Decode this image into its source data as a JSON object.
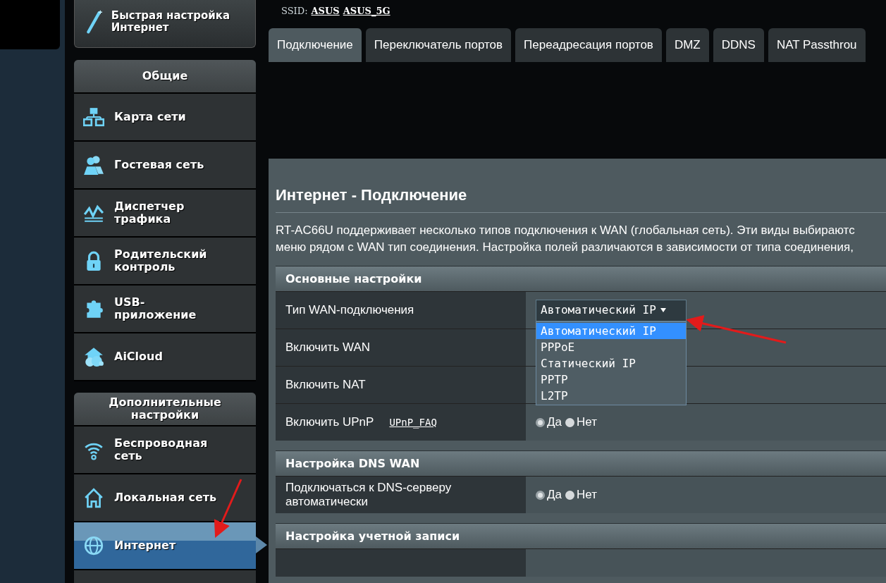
{
  "ssid": {
    "label": "SSID:",
    "links": [
      "ASUS",
      "ASUS_5G"
    ]
  },
  "quick_setup": {
    "label": "Быстрая настройка Интернет"
  },
  "sidebar": {
    "sections": [
      {
        "title": "Общие",
        "items": [
          {
            "label": "Карта сети",
            "selected": false
          },
          {
            "label": "Гостевая сеть",
            "selected": false
          },
          {
            "label": "Диспетчер трафика",
            "selected": false
          },
          {
            "label": "Родительский контроль",
            "selected": false
          },
          {
            "label": "USB-приложение",
            "selected": false
          },
          {
            "label": "AiCloud",
            "selected": false
          }
        ]
      },
      {
        "title": "Дополнительные настройки",
        "items": [
          {
            "label": "Беспроводная сеть",
            "selected": false
          },
          {
            "label": "Локальная сеть",
            "selected": false
          },
          {
            "label": "Интернет",
            "selected": true
          }
        ]
      }
    ]
  },
  "tabs": [
    {
      "label": "Подключение",
      "selected": true
    },
    {
      "label": "Переключатель портов",
      "selected": false
    },
    {
      "label": "Переадресация портов",
      "selected": false
    },
    {
      "label": "DMZ",
      "selected": false
    },
    {
      "label": "DDNS",
      "selected": false
    },
    {
      "label": "NAT Passthrou",
      "selected": false
    }
  ],
  "page": {
    "title": "Интернет - Подключение",
    "description": [
      "RT-AC66U поддерживает несколько типов подключения к WAN (глобальная сеть). Эти виды выбираютс",
      "меню рядом с WAN тип соединения. Настройка полей различаются в зависимости от типа соединения,"
    ],
    "sections": [
      {
        "title": "Основные настройки",
        "rows": [
          {
            "kind": "select",
            "label": "Тип WAN-подключения",
            "value": "Автоматический IP",
            "expanded": true,
            "options": [
              {
                "label": "Автоматический IP",
                "selected": true
              },
              {
                "label": "PPPoE",
                "selected": false
              },
              {
                "label": "Статический IP",
                "selected": false
              },
              {
                "label": "PPTP",
                "selected": false
              },
              {
                "label": "L2TP",
                "selected": false
              }
            ]
          },
          {
            "kind": "plain",
            "label": "Включить WAN"
          },
          {
            "kind": "plain",
            "label": "Включить NAT"
          },
          {
            "kind": "radio",
            "label": "Включить UPnP",
            "link": "UPnP_FAQ",
            "options": [
              {
                "label": "Да",
                "selected": true
              },
              {
                "label": "Нет",
                "selected": false
              }
            ]
          }
        ]
      },
      {
        "title": "Настройка DNS WAN",
        "rows": [
          {
            "kind": "radio",
            "label": "Подключаться к DNS-серверу автоматически",
            "options": [
              {
                "label": "Да",
                "selected": true
              },
              {
                "label": "Нет",
                "selected": false
              }
            ]
          }
        ]
      },
      {
        "title": "Настройка учетной записи"
      }
    ]
  }
}
